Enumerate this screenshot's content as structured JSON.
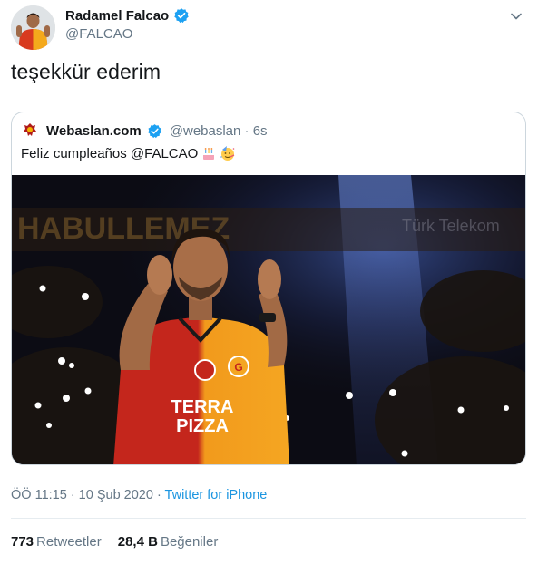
{
  "author": {
    "display_name": "Radamel Falcao",
    "handle": "@FALCAO",
    "verified": true
  },
  "tweet": {
    "text": "teşekkür ederim"
  },
  "quoted_tweet": {
    "display_name": "Webaslan.com",
    "handle_time": "@webaslan · 6s",
    "verified": true,
    "text": "Feliz cumpleaños @FALCAO",
    "emojis": [
      "cake-emoji",
      "party-face-emoji"
    ],
    "image_overlay_text": {
      "jersey_sponsor_line1": "TERRA",
      "jersey_sponsor_line2": "PIZZA",
      "banner_left": "HABULLEMEZ",
      "banner_right": "Türk Telekom"
    }
  },
  "meta": {
    "time_date": "ÖÖ 11:15 · 10 Şub 2020 · ",
    "source": "Twitter for iPhone"
  },
  "stats": {
    "retweets_count": "773",
    "retweets_label": "Retweetler",
    "likes_count": "28,4 B",
    "likes_label": "Beğeniler"
  },
  "colors": {
    "link": "#1b95e0",
    "verified_blue": "#1da1f2",
    "secondary_text": "#657786",
    "border": "#ccd6dd"
  },
  "icons": {
    "menu": "chevron-down-icon",
    "verified": "verified-badge-icon"
  }
}
